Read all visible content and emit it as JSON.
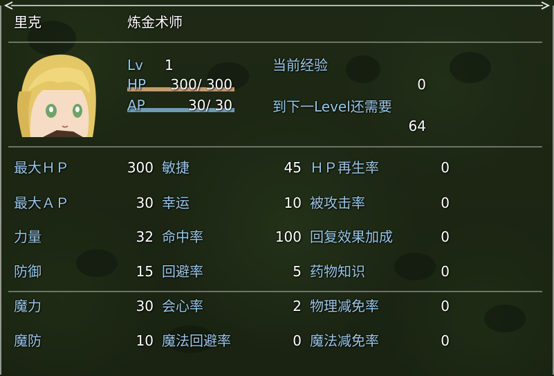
{
  "actor": {
    "name": "里克",
    "class": "炼金术师",
    "level_label": "Lv",
    "level": "1",
    "hp_label": "HP",
    "hp_value": "300/ 300",
    "hp_fraction": 1.0,
    "ap_label": "AP",
    "ap_value": "30/ 30",
    "ap_fraction": 1.0
  },
  "exp": {
    "current_label": "当前经验",
    "current_value": "0",
    "next_label": "到下一Level还需要",
    "next_value": "64"
  },
  "params_col1": [
    {
      "label": "最大ＨＰ",
      "value": "300"
    },
    {
      "label": "最大ＡＰ",
      "value": "30"
    },
    {
      "label": "力量",
      "value": "32"
    },
    {
      "label": "防御",
      "value": "15"
    },
    {
      "label": "魔力",
      "value": "30"
    },
    {
      "label": "魔防",
      "value": "10"
    }
  ],
  "params_col2": [
    {
      "label": "敏捷",
      "value": "45"
    },
    {
      "label": "幸运",
      "value": "10"
    },
    {
      "label": "命中率",
      "value": "100"
    },
    {
      "label": "回避率",
      "value": "5"
    },
    {
      "label": "会心率",
      "value": "2"
    },
    {
      "label": "魔法回避率",
      "value": "0"
    }
  ],
  "params_col3": [
    {
      "label": "ＨＰ再生率",
      "value": "0"
    },
    {
      "label": "被攻击率",
      "value": "0"
    },
    {
      "label": "回复效果加成",
      "value": "0"
    },
    {
      "label": "药物知识",
      "value": "0"
    },
    {
      "label": "物理减免率",
      "value": "0"
    },
    {
      "label": "魔法减免率",
      "value": "0"
    }
  ],
  "colors": {
    "system_text": "#98c6e6",
    "normal_text": "#ffffff",
    "hp_gauge": "#c69a6f",
    "ap_gauge": "#6e9cb8"
  },
  "icons": {
    "portrait": "blonde-girl-portrait",
    "frame_corner": "window-frame-corner"
  }
}
